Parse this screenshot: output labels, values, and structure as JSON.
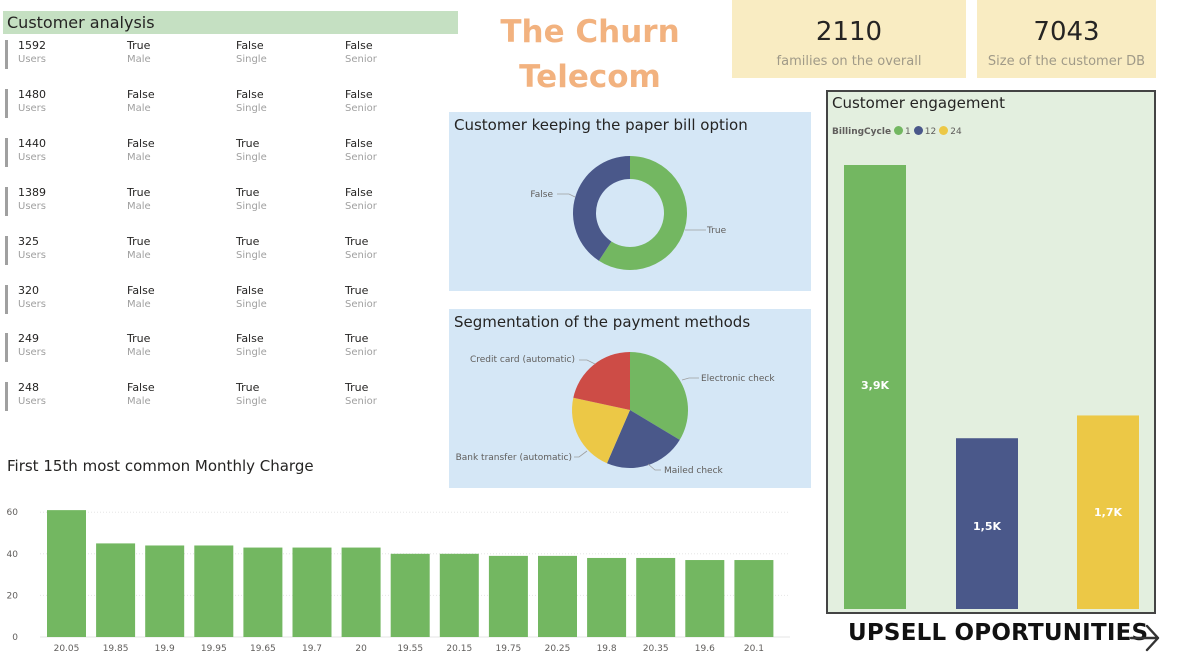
{
  "customer_analysis": {
    "title": "Customer analysis",
    "rows": [
      {
        "users": "1592",
        "gender": "True",
        "single": "False",
        "senior": "False"
      },
      {
        "users": "1480",
        "gender": "False",
        "single": "False",
        "senior": "False"
      },
      {
        "users": "1440",
        "gender": "False",
        "single": "True",
        "senior": "False"
      },
      {
        "users": "1389",
        "gender": "True",
        "single": "True",
        "senior": "False"
      },
      {
        "users": "325",
        "gender": "True",
        "single": "True",
        "senior": "True"
      },
      {
        "users": "320",
        "gender": "False",
        "single": "False",
        "senior": "True"
      },
      {
        "users": "249",
        "gender": "True",
        "single": "False",
        "senior": "True"
      },
      {
        "users": "248",
        "gender": "False",
        "single": "True",
        "senior": "True"
      }
    ],
    "labels": {
      "users": "Users",
      "gender": "Male",
      "single": "Single",
      "senior": "Senior"
    }
  },
  "title": {
    "line1": "The Churn",
    "line2": "Telecom"
  },
  "kpis": [
    {
      "value": "2110",
      "label": "families on the overall"
    },
    {
      "value": "7043",
      "label": "Size of the customer DB"
    }
  ],
  "upsell": {
    "label": "UPSELL OPORTUNITIES"
  },
  "colors": {
    "green": "#73b761",
    "navy": "#4a588a",
    "yellow": "#ecc846",
    "red": "#cd4c46",
    "title": "#f2b27f"
  },
  "chart_data": [
    {
      "type": "pie",
      "variant": "donut",
      "title": "Customer keeping the paper bill option",
      "categories": [
        "True",
        "False"
      ],
      "values": [
        59.2,
        40.8
      ]
    },
    {
      "type": "pie",
      "title": "Segmentation of the payment methods",
      "categories": [
        "Electronic check",
        "Mailed check",
        "Bank transfer (automatic)",
        "Credit card (automatic)"
      ],
      "values": [
        33.6,
        22.9,
        21.9,
        21.6
      ]
    },
    {
      "type": "bar",
      "title": "Customer engagement",
      "legend_title": "BillingCycle",
      "legend_position": "top-left",
      "categories": [
        "1",
        "12",
        "24"
      ],
      "values": [
        3900,
        1500,
        1700
      ],
      "data_labels": [
        "3,9K",
        "1,5K",
        "1,7K"
      ]
    },
    {
      "type": "bar",
      "title": "First 15th most common Monthly Charge",
      "categories": [
        "20.05",
        "19.85",
        "19.9",
        "19.95",
        "19.65",
        "19.7",
        "20",
        "19.55",
        "20.15",
        "19.75",
        "20.25",
        "19.8",
        "20.35",
        "19.6",
        "20.1"
      ],
      "values": [
        61,
        45,
        44,
        44,
        43,
        43,
        43,
        40,
        40,
        39,
        39,
        38,
        38,
        37,
        37
      ],
      "ylim": [
        0,
        70
      ],
      "yticks": [
        0,
        20,
        40,
        60
      ],
      "grid": true
    }
  ]
}
